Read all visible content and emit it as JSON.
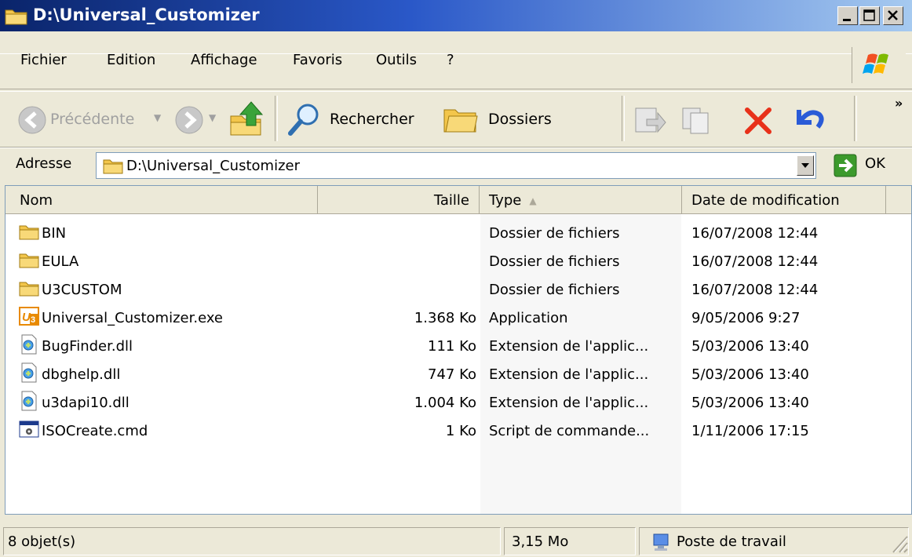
{
  "window": {
    "title": "D:\\Universal_Customizer"
  },
  "menu": [
    "Fichier",
    "Edition",
    "Affichage",
    "Favoris",
    "Outils",
    "?"
  ],
  "toolbar": {
    "back_label": "Précédente",
    "search_label": "Rechercher",
    "folders_label": "Dossiers"
  },
  "address": {
    "label": "Adresse",
    "value": "D:\\Universal_Customizer",
    "go_label": "OK"
  },
  "columns": {
    "name": "Nom",
    "size": "Taille",
    "type": "Type",
    "date": "Date de modification"
  },
  "files": [
    {
      "name": "BIN",
      "size": "",
      "type": "Dossier de fichiers",
      "date": "16/07/2008 12:44",
      "icon": "folder-icon"
    },
    {
      "name": "EULA",
      "size": "",
      "type": "Dossier de fichiers",
      "date": "16/07/2008 12:44",
      "icon": "folder-icon"
    },
    {
      "name": "U3CUSTOM",
      "size": "",
      "type": "Dossier de fichiers",
      "date": "16/07/2008 12:44",
      "icon": "folder-icon"
    },
    {
      "name": "Universal_Customizer.exe",
      "size": "1.368 Ko",
      "type": "Application",
      "date": "9/05/2006 9:27",
      "icon": "u3-app-icon"
    },
    {
      "name": "BugFinder.dll",
      "size": "111 Ko",
      "type": "Extension de l'applic...",
      "date": "5/03/2006 13:40",
      "icon": "dll-icon"
    },
    {
      "name": "dbghelp.dll",
      "size": "747 Ko",
      "type": "Extension de l'applic...",
      "date": "5/03/2006 13:40",
      "icon": "dll-icon"
    },
    {
      "name": "u3dapi10.dll",
      "size": "1.004 Ko",
      "type": "Extension de l'applic...",
      "date": "5/03/2006 13:40",
      "icon": "dll-icon"
    },
    {
      "name": "ISOCreate.cmd",
      "size": "1 Ko",
      "type": "Script de commande...",
      "date": "1/11/2006 17:15",
      "icon": "cmd-script-icon"
    }
  ],
  "status": {
    "count": "8 objet(s)",
    "size": "3,15 Mo",
    "zone": "Poste de travail"
  }
}
